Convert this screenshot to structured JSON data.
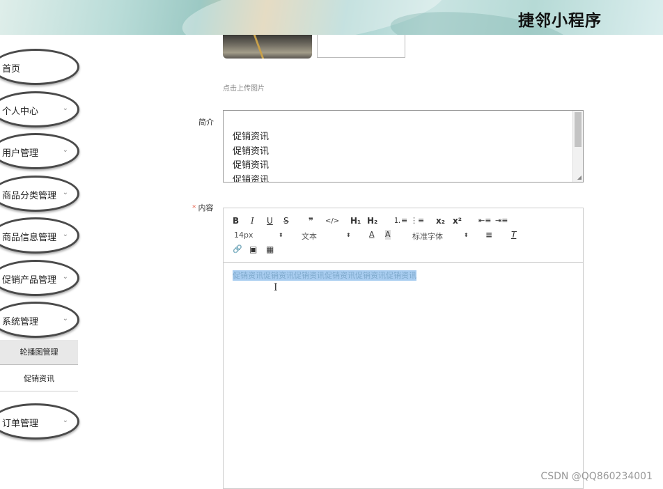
{
  "header": {
    "title": "捷邻小程序"
  },
  "sidebar": {
    "items": [
      {
        "label": "首页",
        "chevron": ""
      },
      {
        "label": "个人中心",
        "chevron": "⌄"
      },
      {
        "label": "用户管理",
        "chevron": "⌄"
      },
      {
        "label": "商品分类管理",
        "chevron": "⌄"
      },
      {
        "label": "商品信息管理",
        "chevron": "⌄"
      },
      {
        "label": "促销产品管理",
        "chevron": "⌄"
      },
      {
        "label": "系统管理",
        "chevron": "⌄"
      },
      {
        "label": "订单管理",
        "chevron": "⌄"
      }
    ],
    "subitems": [
      {
        "label": "轮播图管理"
      },
      {
        "label": "促销资讯"
      }
    ]
  },
  "form": {
    "upload_hint": "点击上传图片",
    "intro_label": "简介",
    "intro_lines": [
      "促销资讯",
      "促销资讯",
      "促销资讯",
      "促销资讯"
    ],
    "content_label": "内容",
    "content_required_mark": "*",
    "content_text": "促销资讯促销资讯促销资讯促销资讯促销资讯促销资讯"
  },
  "editor": {
    "bold": "B",
    "italic": "I",
    "underline": "U",
    "strike": "S",
    "quote": "❞",
    "code": "</>",
    "h1": "H₁",
    "h2": "H₂",
    "ordered_list": "⒈≡",
    "bullet_list": "⋮≡",
    "subscript": "x₂",
    "superscript": "x²",
    "outdent": "⇤≡",
    "indent": "⇥≡",
    "font_size": "14px",
    "header_select": "文本",
    "font_color": "A",
    "bg_color": "A",
    "font_family": "标准字体",
    "align": "≡",
    "clean": "T",
    "select_arrow": "⬍",
    "link": "🔗",
    "image": "▣",
    "video": "▦"
  },
  "watermark": "CSDN @QQ860234001"
}
